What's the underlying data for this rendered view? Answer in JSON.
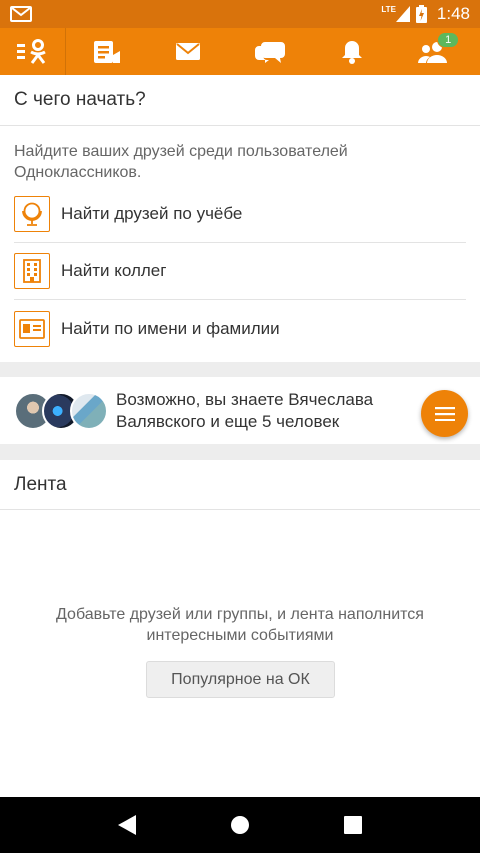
{
  "status_bar": {
    "network": "LTE",
    "time": "1:48"
  },
  "toolbar": {
    "notification_badge": "1",
    "icons": [
      "ok-logo-icon",
      "feed-icon",
      "messages-icon",
      "discussions-icon",
      "notifications-icon",
      "friends-icon"
    ]
  },
  "start": {
    "title": "С чего начать?",
    "description": "Найдите ваших друзей среди пользователей Одноклассников.",
    "actions": [
      {
        "label": "Найти друзей по учёбе",
        "icon": "globe-icon"
      },
      {
        "label": "Найти коллег",
        "icon": "building-icon"
      },
      {
        "label": "Найти по имени и фамилии",
        "icon": "id-card-icon"
      }
    ]
  },
  "suggestions": {
    "text": "Возможно, вы знаете Вячеслава Валявского и еще 5 человек"
  },
  "feed": {
    "title": "Лента",
    "empty_message": "Добавьте друзей или группы, и лента наполнится интересными событиями",
    "popular_button": "Популярное на ОК"
  },
  "colors": {
    "accent": "#ee8208",
    "status_bar": "#d9730c",
    "badge": "#5cb85c"
  }
}
